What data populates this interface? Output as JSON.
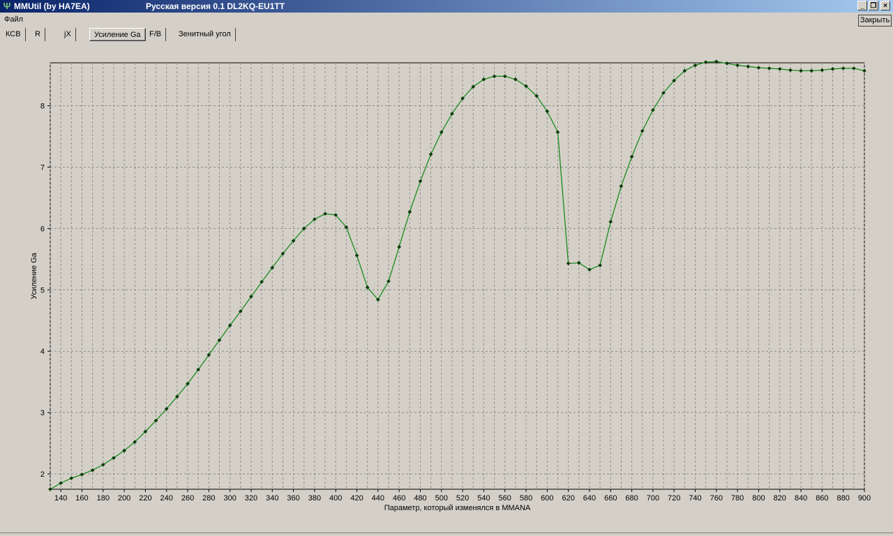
{
  "window": {
    "title": "MMUtil (by HA7EA)",
    "subtitle": "Русская версия 0.1 DL2KQ-EU1TT",
    "minimize_glyph": "_",
    "restore_glyph": "❐",
    "close_glyph": "×",
    "icon": "antenna-icon"
  },
  "menu": {
    "file_label": "Файл"
  },
  "close_button": {
    "label": "Закрыть"
  },
  "tabs": [
    {
      "label": "КСВ",
      "active": false
    },
    {
      "label": "R",
      "active": false
    },
    {
      "label": "jX",
      "active": false
    },
    {
      "label": "Усиление Ga",
      "active": true
    },
    {
      "label": "F/B",
      "active": false
    },
    {
      "label": "Зенитный угол",
      "active": false
    }
  ],
  "colors": {
    "line": "#1a8a1a",
    "marker": "#0a3a0a",
    "grid": "#8c8c8c",
    "plot_bg": "#d4d0c8"
  },
  "chart_data": {
    "type": "line",
    "xlabel": "Параметр, который изменялся в MMANA",
    "ylabel": "Усиление Ga",
    "xlim": [
      130,
      900
    ],
    "ylim": [
      1.75,
      8.7
    ],
    "x_ticks": [
      140,
      160,
      180,
      200,
      220,
      240,
      260,
      280,
      300,
      320,
      340,
      360,
      380,
      400,
      420,
      440,
      460,
      480,
      500,
      520,
      540,
      560,
      580,
      600,
      620,
      640,
      660,
      680,
      700,
      720,
      740,
      760,
      780,
      800,
      820,
      840,
      860,
      880,
      900
    ],
    "y_ticks": [
      2,
      3,
      4,
      5,
      6,
      7,
      8
    ],
    "grid": true,
    "series": [
      {
        "x": [
          130,
          140,
          150,
          160,
          170,
          180,
          190,
          200,
          210,
          220,
          230,
          240,
          250,
          260,
          270,
          280,
          290,
          300,
          310,
          320,
          330,
          340,
          350,
          360,
          370,
          380,
          390,
          400,
          410,
          420,
          430,
          440,
          450,
          460,
          470,
          480,
          490,
          500,
          510,
          520,
          530,
          540,
          550,
          560,
          570,
          580,
          590,
          600,
          610,
          620,
          630,
          640,
          650,
          660,
          670,
          680,
          690,
          700,
          710,
          720,
          730,
          740,
          750,
          760,
          770,
          780,
          790,
          800,
          810,
          820,
          830,
          840,
          850,
          860,
          870,
          880,
          890,
          900
        ],
        "y": [
          1.75,
          1.85,
          1.93,
          1.99,
          2.06,
          2.15,
          2.26,
          2.38,
          2.52,
          2.69,
          2.87,
          3.06,
          3.26,
          3.47,
          3.7,
          3.94,
          4.18,
          4.42,
          4.65,
          4.89,
          5.13,
          5.36,
          5.59,
          5.8,
          6.0,
          6.15,
          6.24,
          6.22,
          6.02,
          5.56,
          5.04,
          4.84,
          5.14,
          5.7,
          6.27,
          6.77,
          7.21,
          7.57,
          7.87,
          8.12,
          8.31,
          8.43,
          8.48,
          8.48,
          8.43,
          8.32,
          8.16,
          7.91,
          7.57,
          5.43,
          5.44,
          5.33,
          5.4,
          6.11,
          6.69,
          7.17,
          7.59,
          7.93,
          8.21,
          8.41,
          8.57,
          8.66,
          8.71,
          8.72,
          8.69,
          8.66,
          8.64,
          8.62,
          8.61,
          8.6,
          8.58,
          8.57,
          8.57,
          8.58,
          8.6,
          8.61,
          8.61,
          8.57
        ]
      }
    ]
  }
}
